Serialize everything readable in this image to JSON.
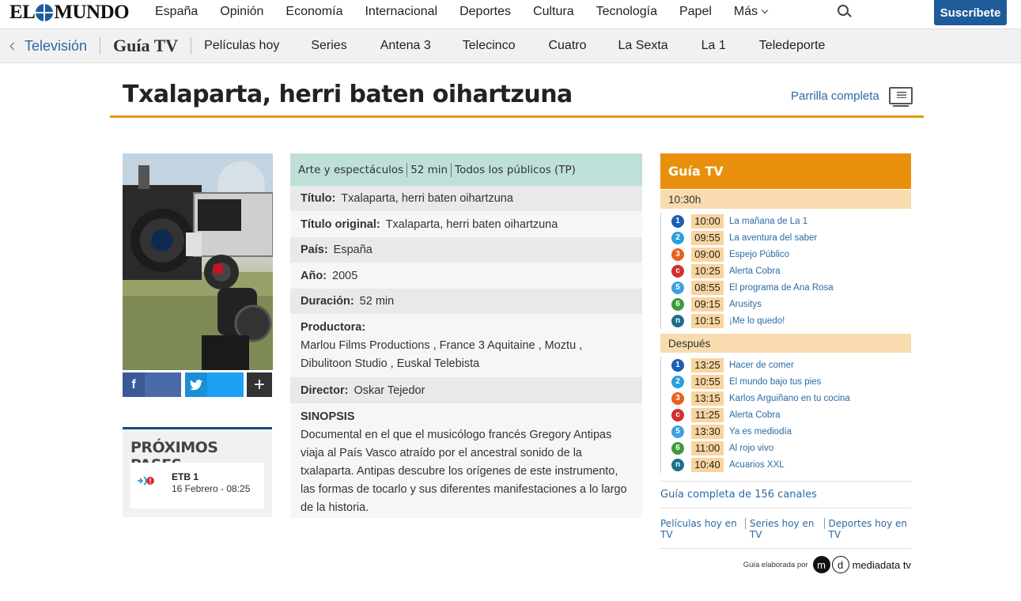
{
  "brand": {
    "logo_left": "EL",
    "logo_right": "MUNDO"
  },
  "topnav": {
    "items": [
      "España",
      "Opinión",
      "Economía",
      "Internacional",
      "Deportes",
      "Cultura",
      "Tecnología",
      "Papel"
    ],
    "more_label": "Más",
    "subscribe_label": "Suscríbete"
  },
  "subnav": {
    "back_label": "Televisión",
    "section_label": "Guía TV",
    "items": [
      "Películas hoy",
      "Series",
      "Antena 3",
      "Telecinco",
      "Cuatro",
      "La Sexta",
      "La 1",
      "Teledeporte"
    ]
  },
  "page": {
    "title": "Txalaparta, herri baten oihartzuna",
    "full_grid_label": "Parrilla completa"
  },
  "share": {
    "fb": "f",
    "tw": "t",
    "more": "+"
  },
  "upcoming": {
    "heading": "PRÓXIMOS PASES",
    "channel": "ETB 1",
    "date": "16 Febrero - 08:25"
  },
  "details": {
    "genre": "Arte y espectáculos",
    "duration_short": "52 min",
    "rating": "Todos los públicos (TP)",
    "rows": [
      {
        "label": "Título:",
        "value": "Txalaparta, herri baten oihartzuna"
      },
      {
        "label": "Título original:",
        "value": "Txalaparta, herri baten oihartzuna"
      },
      {
        "label": "País:",
        "value": "España"
      },
      {
        "label": "Año:",
        "value": "2005"
      },
      {
        "label": "Duración:",
        "value": "52 min"
      }
    ],
    "producer_label": "Productora:",
    "producer_value": "Marlou Films Productions , France 3 Aquitaine , Moztu , Dibulitoon Studio , Euskal Telebista",
    "director_label": "Director:",
    "director_value": "Oskar Tejedor",
    "synopsis_label": "SINOPSIS",
    "synopsis": "Documental en el que el musicólogo francés Gregory Antipas viaja al País Vasco atraído por el ancestral sonido de la txalaparta. Antipas descubre los orígenes de este instrumento, las formas de tocarlo y sus diferentes manifestaciones a lo largo de la historia."
  },
  "guide": {
    "heading": "Guía TV",
    "now_label": "10:30h",
    "now": [
      {
        "icon": "1",
        "color": "#1a5fb4",
        "time": "10:00",
        "title": "La mañana de La 1"
      },
      {
        "icon": "2",
        "color": "#2aa0d8",
        "time": "09:55",
        "title": "La aventura del saber"
      },
      {
        "icon": "3",
        "color": "#e8601c",
        "time": "09:00",
        "title": "Espejo Público"
      },
      {
        "icon": "c",
        "color": "#d3302b",
        "time": "10:25",
        "title": "Alerta Cobra"
      },
      {
        "icon": "5",
        "color": "#3aa3dd",
        "time": "08:55",
        "title": "El programa de Ana Rosa"
      },
      {
        "icon": "6",
        "color": "#3d9b3a",
        "time": "09:15",
        "title": "Arusitys"
      },
      {
        "icon": "n",
        "color": "#1c6f8a",
        "time": "10:15",
        "title": "¡Me lo quedo!"
      }
    ],
    "after_label": "Después",
    "after": [
      {
        "icon": "1",
        "color": "#1a5fb4",
        "time": "13:25",
        "title": "Hacer de comer"
      },
      {
        "icon": "2",
        "color": "#2aa0d8",
        "time": "10:55",
        "title": "El mundo bajo tus pies"
      },
      {
        "icon": "3",
        "color": "#e8601c",
        "time": "13:15",
        "title": "Karlos Arguiñano en tu cocina"
      },
      {
        "icon": "c",
        "color": "#d3302b",
        "time": "11:25",
        "title": "Alerta Cobra"
      },
      {
        "icon": "5",
        "color": "#3aa3dd",
        "time": "13:30",
        "title": "Ya es mediodía"
      },
      {
        "icon": "6",
        "color": "#3d9b3a",
        "time": "11:00",
        "title": "Al rojo vivo"
      },
      {
        "icon": "n",
        "color": "#1c6f8a",
        "time": "10:40",
        "title": "Acuarios XXL"
      }
    ],
    "full_guide_label": "Guía completa de 156 canales",
    "links": [
      "Películas hoy en TV",
      "Series hoy en TV",
      "Deportes hoy en TV"
    ],
    "credit_label": "Guía elaborada por",
    "credit_m": "m",
    "credit_d": "d",
    "credit_name": "mediadata tv"
  }
}
